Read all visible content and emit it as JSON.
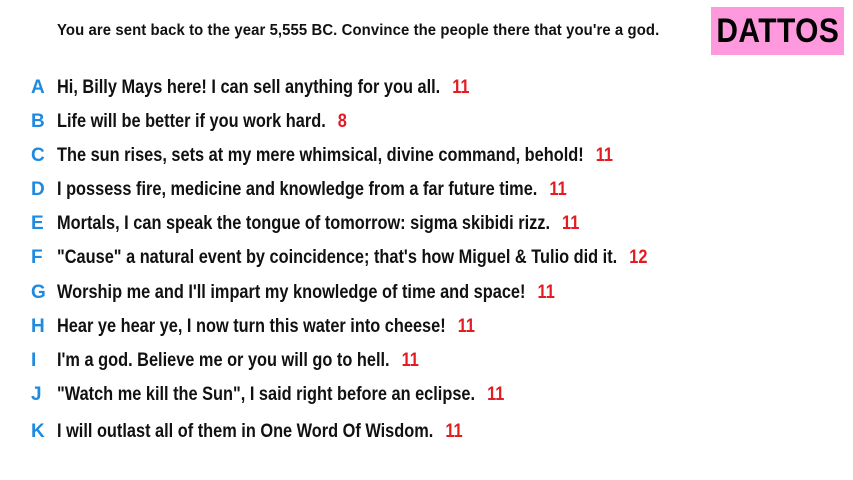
{
  "prompt": "You are sent back to the year 5,555 BC. Convince the people there that you're a god.",
  "badge": {
    "label": "DATTOS",
    "color": "#ff99dd"
  },
  "colors": {
    "letter": "#1e8ae0",
    "count": "#e31b23",
    "text": "#111111"
  },
  "answers": [
    {
      "letter": "A",
      "text": "Hi, Billy Mays here! I can sell anything for you all.",
      "count": "11"
    },
    {
      "letter": "B",
      "text": "Life will be better if you work hard.",
      "count": "8"
    },
    {
      "letter": "C",
      "text": "The sun rises, sets at my mere whimsical, divine command, behold!",
      "count": "11"
    },
    {
      "letter": "D",
      "text": "I possess fire, medicine and knowledge from a far future time.",
      "count": "11"
    },
    {
      "letter": "E",
      "text": "Mortals, I can speak the tongue of tomorrow: sigma skibidi rizz.",
      "count": "11"
    },
    {
      "letter": "F",
      "text": "\"Cause\" a natural event by coincidence; that's how Miguel & Tulio did it.",
      "count": "12"
    },
    {
      "letter": "G",
      "text": "Worship me and I'll impart my knowledge of time and space!",
      "count": "11"
    },
    {
      "letter": "H",
      "text": "Hear ye hear ye, I now turn this water into cheese!",
      "count": "11"
    },
    {
      "letter": "I",
      "text": "I'm a god. Believe me or you will go to hell.",
      "count": "11"
    },
    {
      "letter": "J",
      "text": "\"Watch me kill the Sun\", I said right before an eclipse.",
      "count": "11"
    },
    {
      "letter": "K",
      "text": "I will outlast all of them in One Word Of Wisdom.",
      "count": "11"
    }
  ]
}
